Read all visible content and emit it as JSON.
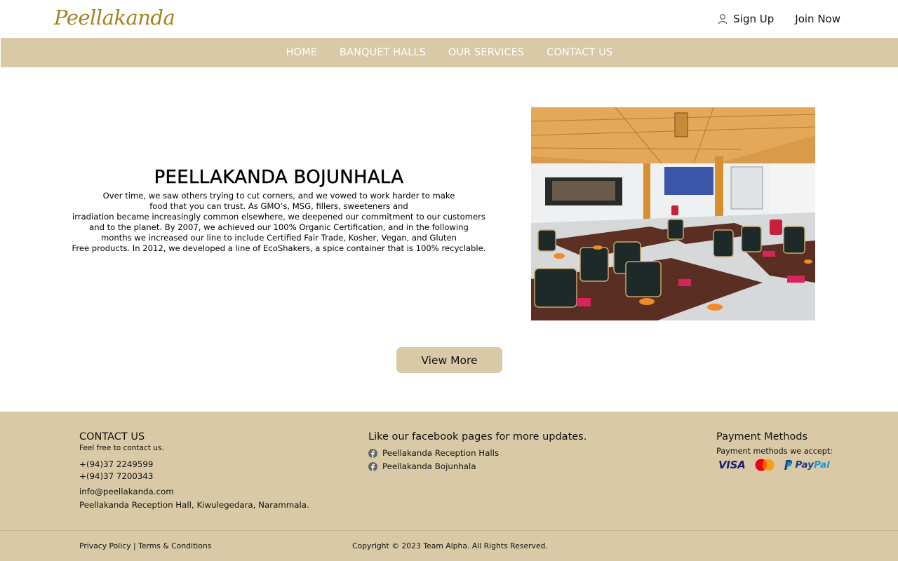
{
  "header": {
    "logo": "Peellakanda",
    "sign_up": "Sign Up",
    "join_now": "Join Now"
  },
  "nav": {
    "items": [
      "HOME",
      "BANQUET HALLS",
      "OUR SERVICES",
      "CONTACT US"
    ]
  },
  "hero": {
    "title": "PEELLAKANDA BOJUNHALA",
    "body_lines": [
      "Over time, we saw others trying to cut corners, and we vowed to work harder to make",
      "food that you can trust. As GMO’s, MSG, fillers, sweeteners and",
      "irradiation became increasingly common elsewhere, we deepened our commitment to our customers",
      "and to the planet. By 2007, we achieved our 100% Organic Certification, and in the following",
      "months we increased our line to include Certified Fair Trade, Kosher, Vegan, and Gluten",
      "Free products. In 2012, we developed a line of EcoShakers, a spice container that is 100% recyclable."
    ],
    "button": "View More"
  },
  "footer": {
    "contact": {
      "heading": "CONTACT US",
      "subtitle": "Feel free to contact us.",
      "phone1": "+(94)37 2249599",
      "phone2": "+(94)37 7200343",
      "email": "info@peellakanda.com",
      "address": "Peellakanda Reception Hall, Kiwulegedara, Narammala."
    },
    "facebook": {
      "heading": "Like our facebook pages for more updates.",
      "pages": [
        "Peellakanda Reception Halls",
        "Peellakanda Bojunhala"
      ]
    },
    "payment": {
      "heading": "Payment Methods",
      "subtitle": "Payment methods we accept:",
      "visa": "VISA",
      "mastercard": "MasterCard",
      "paypal_1": "Pay",
      "paypal_2": "Pal"
    },
    "privacy": "Privacy Policy",
    "separator": " | ",
    "terms": "Terms & Conditions",
    "copyright": "Copyright © 2023 Team Alpha. All Rights Reserved."
  },
  "colors": {
    "accent_beige": "#d9c9a6",
    "logo_gold": "#a8801f"
  }
}
